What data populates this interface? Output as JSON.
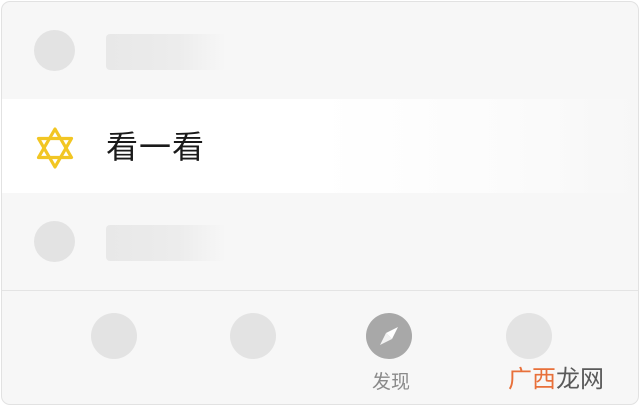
{
  "list": {
    "featured_item": {
      "label": "看一看",
      "icon": "star-of-david-icon",
      "icon_color": "#f2c623"
    }
  },
  "tabbar": {
    "active_tab": {
      "label": "发现",
      "icon": "compass-icon"
    }
  },
  "watermark": {
    "part1": "广西",
    "part2": "龙网",
    "part1_color": "#e8703a",
    "part2_color": "#5a5a5a"
  }
}
